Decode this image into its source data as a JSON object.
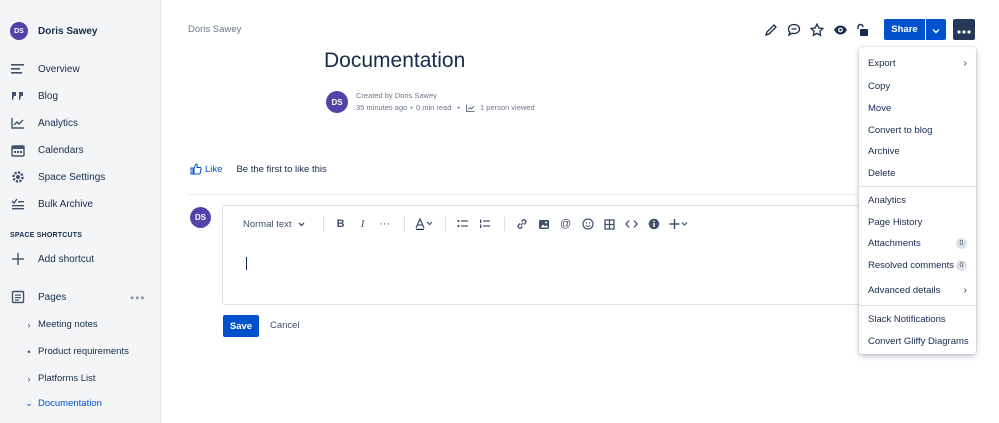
{
  "sidebar": {
    "space_avatar": "DS",
    "space_name": "Doris Sawey",
    "nav": [
      {
        "label": "Overview",
        "icon": "overview-icon"
      },
      {
        "label": "Blog",
        "icon": "quote-icon"
      },
      {
        "label": "Analytics",
        "icon": "analytics-icon"
      },
      {
        "label": "Calendars",
        "icon": "calendar-icon"
      },
      {
        "label": "Space Settings",
        "icon": "gear-icon"
      },
      {
        "label": "Bulk Archive",
        "icon": "checklist-icon"
      }
    ],
    "shortcuts_label": "SPACE SHORTCUTS",
    "add_shortcut": "Add shortcut",
    "pages_label": "Pages",
    "pages_more": "•••",
    "tree": [
      {
        "label": "Meeting notes",
        "marker": "›"
      },
      {
        "label": "Product requirements",
        "marker": "•"
      },
      {
        "label": "Platforms List",
        "marker": "›"
      },
      {
        "label": "Documentation",
        "marker": "⌄"
      }
    ]
  },
  "header": {
    "breadcrumb": "Doris Sawey",
    "share_label": "Share"
  },
  "page": {
    "title": "Documentation",
    "author_avatar": "DS",
    "created_by": "Created by Doris Sawey",
    "time_ago": "35 minutes ago",
    "read_time": "0 min read",
    "viewed": "1 person viewed",
    "sep": "•"
  },
  "likes": {
    "like_label": "Like",
    "message": "Be the first to like this"
  },
  "comment": {
    "avatar": "DS",
    "text_style": "Normal text",
    "save_label": "Save",
    "cancel_label": "Cancel"
  },
  "menu": {
    "items": [
      {
        "label": "Export",
        "has_arrow": true
      },
      {
        "label": "Copy"
      },
      {
        "label": "Move"
      },
      {
        "label": "Convert to blog"
      },
      {
        "label": "Archive"
      },
      {
        "label": "Delete"
      },
      {
        "label": "Analytics"
      },
      {
        "label": "Page History"
      },
      {
        "label": "Attachments",
        "count": "0"
      },
      {
        "label": "Resolved comments",
        "count": "0"
      },
      {
        "label": "Advanced details",
        "has_arrow": true
      },
      {
        "label": "Slack Notifications"
      },
      {
        "label": "Convert Gliffy Diagrams"
      }
    ]
  },
  "colors": {
    "primary": "#0052CC",
    "avatar": "#5243AA",
    "dark_button": "#253858",
    "sidebar_bg": "#F4F5F7"
  }
}
